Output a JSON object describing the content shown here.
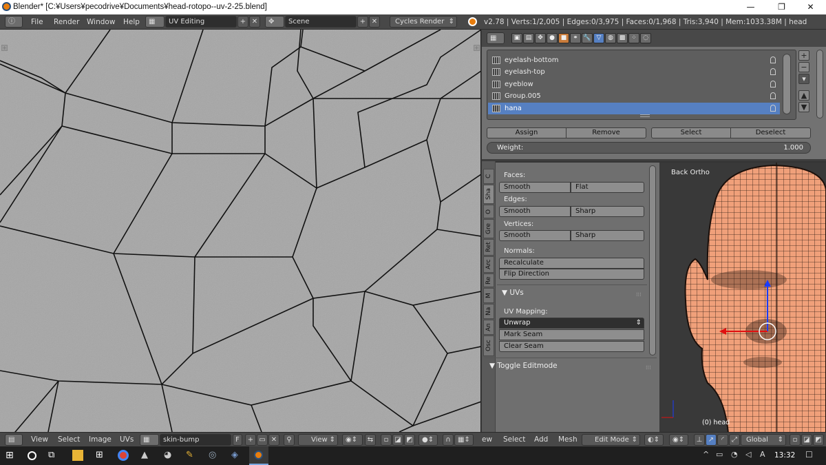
{
  "window": {
    "title": "Blender* [C:¥Users¥pecodrive¥Documents¥head-rotopo--uv-2-25.blend]",
    "minimize": "—",
    "maximize": "❐",
    "close": "✕"
  },
  "topbar": {
    "menus": [
      "File",
      "Render",
      "Window",
      "Help"
    ],
    "screen_layout": "UV Editing",
    "scene": "Scene",
    "render_engine": "Cycles Render",
    "status": "v2.78 | Verts:1/2,005 | Edges:0/3,975 | Faces:0/1,968 | Tris:3,940 | Mem:1033.38M | head"
  },
  "vertex_groups": {
    "items": [
      {
        "label": "eyelash-bottom",
        "selected": false
      },
      {
        "label": "eyelash-top",
        "selected": false
      },
      {
        "label": "eyeblow",
        "selected": false
      },
      {
        "label": "Group.005",
        "selected": false
      },
      {
        "label": "hana",
        "selected": true
      }
    ],
    "buttons": {
      "assign": "Assign",
      "remove": "Remove",
      "select": "Select",
      "deselect": "Deselect"
    },
    "weight_label": "Weight:",
    "weight_value": "1.000",
    "side": {
      "add": "+",
      "remove": "−",
      "menu": "▾",
      "up": "▲",
      "down": "▼"
    }
  },
  "tools": {
    "tabs": [
      "C",
      "Sha",
      "O",
      "Gre",
      "Ret",
      "Arc",
      "Re",
      "M",
      "Na",
      "An",
      "Osc"
    ],
    "faces_label": "Faces:",
    "faces_smooth": "Smooth",
    "faces_flat": "Flat",
    "edges_label": "Edges:",
    "edges_smooth": "Smooth",
    "edges_sharp": "Sharp",
    "vertices_label": "Vertices:",
    "vertices_smooth": "Smooth",
    "vertices_sharp": "Sharp",
    "normals_label": "Normals:",
    "recalculate": "Recalculate",
    "flip_direction": "Flip Direction",
    "uvs_header": "UVs",
    "uv_mapping_label": "UV Mapping:",
    "unwrap": "Unwrap",
    "mark_seam": "Mark Seam",
    "clear_seam": "Clear Seam",
    "toggle_editmode": "Toggle Editmode"
  },
  "viewport": {
    "view_label": "Back Ortho",
    "object_label": "(0) head"
  },
  "uv_header": {
    "menus": [
      "View",
      "Select",
      "Image",
      "UVs"
    ],
    "image_name": "skin-bump",
    "f_label": "F",
    "view_dropdown": "View"
  },
  "vp_header": {
    "menus": [
      "ew",
      "Select",
      "Add",
      "Mesh"
    ],
    "mode": "Edit Mode",
    "orientation": "Global"
  },
  "taskbar": {
    "time": "13:32"
  },
  "colors": {
    "selection": "#5680c2",
    "ui_dark": "#484848",
    "uv_background": "#a4a4a4",
    "skin": "#f0a07a"
  }
}
